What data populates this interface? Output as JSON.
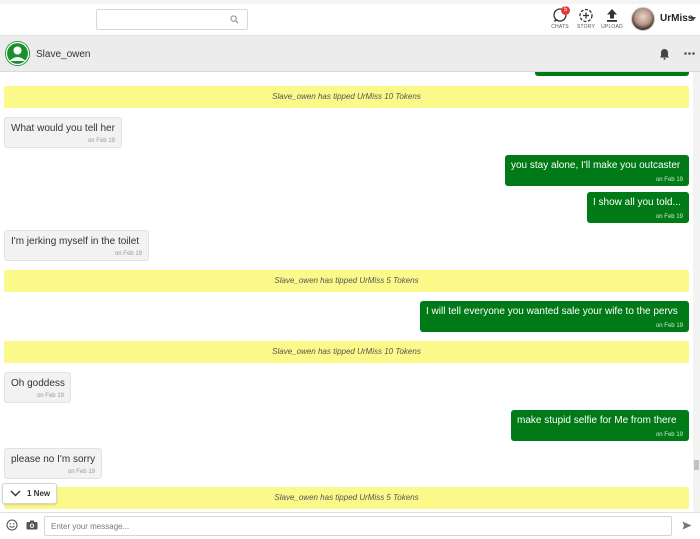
{
  "topbar": {
    "search": {
      "value": "",
      "placeholder": "",
      "icon": "search-icon"
    },
    "nav": [
      {
        "label": "CHATS",
        "icon": "chat-bubble-icon",
        "badge": "5"
      },
      {
        "label": "STORY",
        "icon": "story-add-icon"
      },
      {
        "label": "UPLOAD",
        "icon": "upload-icon"
      }
    ],
    "profile": {
      "name": "UrMiss",
      "icon": "caret-down-icon"
    }
  },
  "chat_header": {
    "name": "Slave_owen",
    "avatar_icon": "user-avatar-icon",
    "actions": [
      "bell-icon",
      "more-icon"
    ]
  },
  "colors": {
    "outgoing": "#007a16",
    "incoming": "#f2f2f2",
    "tip": "#fbf98a"
  },
  "messages": [
    {
      "type": "out",
      "text": "",
      "time": ""
    },
    {
      "type": "tip",
      "text": "Slave_owen has tipped UrMiss 10 Tokens"
    },
    {
      "type": "in",
      "text": "What would you tell her",
      "time": "on Feb 19"
    },
    {
      "type": "out",
      "text": "you stay alone, I'll make you outcaster",
      "time": "on Feb 19"
    },
    {
      "type": "out",
      "text": "I show all you told...",
      "time": "on Feb 19"
    },
    {
      "type": "in",
      "text": "I'm jerking myself in the toilet",
      "time": "on Feb 19"
    },
    {
      "type": "tip",
      "text": "Slave_owen has tipped UrMiss 5 Tokens"
    },
    {
      "type": "out",
      "text": "I will tell everyone you wanted sale your wife to the pervs",
      "time": "on Feb 19"
    },
    {
      "type": "tip",
      "text": "Slave_owen has tipped UrMiss 10 Tokens"
    },
    {
      "type": "in",
      "text": "Oh goddess",
      "time": "on Feb 19"
    },
    {
      "type": "out",
      "text": "make stupid selfie for Me from there",
      "time": "on Feb 19"
    },
    {
      "type": "in",
      "text": "please no I'm sorry",
      "time": "on Feb 19"
    },
    {
      "type": "tip",
      "text": "Slave_owen has tipped UrMiss 5 Tokens"
    }
  ],
  "new_messages": {
    "label": "1 New",
    "icon": "chevron-down-icon"
  },
  "composer": {
    "placeholder": "Enter your message...",
    "value": "",
    "icons": [
      "emoji-icon",
      "camera-icon",
      "send-icon"
    ]
  }
}
